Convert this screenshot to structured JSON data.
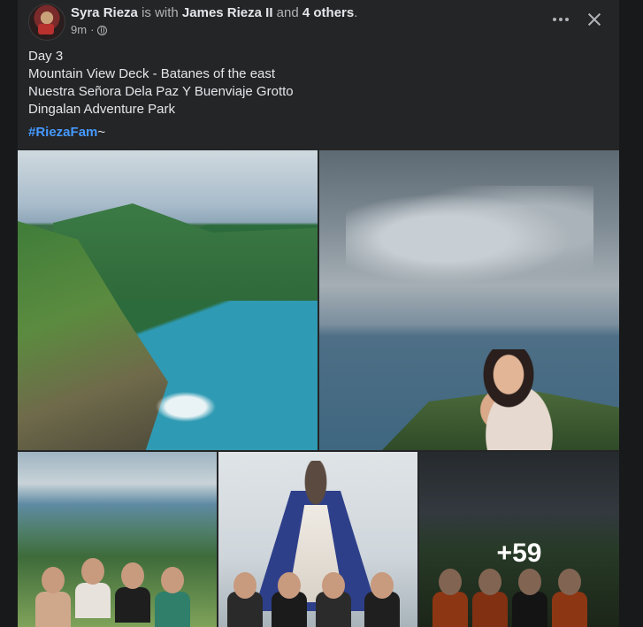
{
  "post": {
    "author": "Syra Rieza",
    "with_text": "is with",
    "tagged": "James Rieza II",
    "and_text": "and",
    "others": "4 others",
    "period": ".",
    "time": "9m",
    "dot": "·",
    "caption_lines": [
      "Day 3",
      "Mountain View Deck - Batanes of the east",
      "Nuestra Señora Dela Paz Y Buenviaje Grotto",
      "Dingalan Adventure Park"
    ],
    "hashtag": "#RiezaFam",
    "hashtag_suffix": "~",
    "more_photos": "+59"
  },
  "colors": {
    "background": "#18191a",
    "card": "#242526",
    "text": "#e4e6eb",
    "muted": "#b0b3b8",
    "link": "#4599ff"
  },
  "icons": {
    "privacy": "globe-icon",
    "more": "more-horizontal-icon",
    "close": "close-icon"
  }
}
